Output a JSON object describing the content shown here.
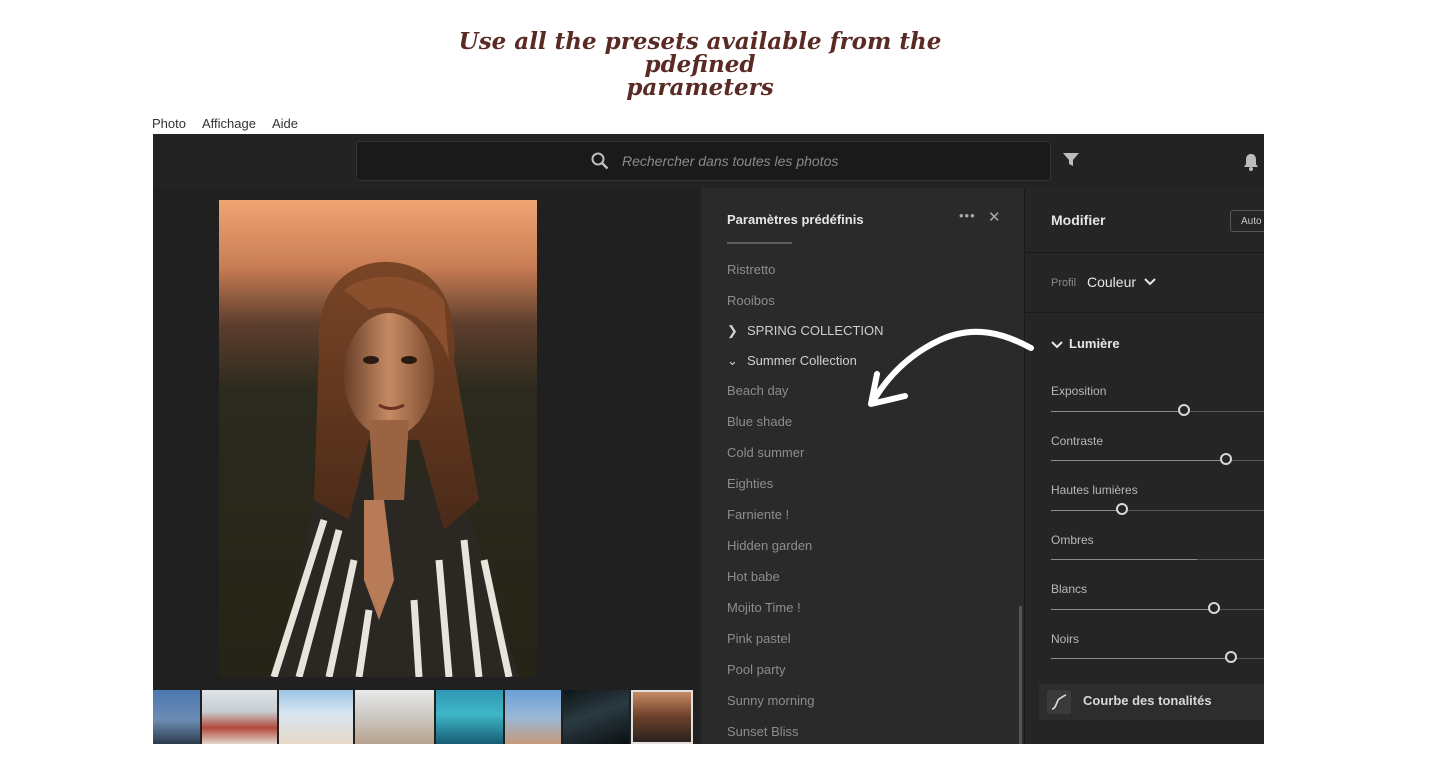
{
  "headline": {
    "line1": "Use all the presets available from the pdefined",
    "line2": "parameters"
  },
  "menubar": [
    "Photo",
    "Affichage",
    "Aide"
  ],
  "search": {
    "placeholder": "Rechercher dans toutes les photos",
    "icon": "search-icon"
  },
  "toolbar_icons": [
    "filter-icon",
    "bell-icon"
  ],
  "presets_panel": {
    "title": "Paramètres prédéfinis",
    "more": "•••",
    "close": "✕",
    "items_before": [
      "Ristretto",
      "Rooibos"
    ],
    "group_collapsed": "SPRING COLLECTION",
    "group_expanded": "Summer Collection",
    "summer_items": [
      "Beach day",
      "Blue shade",
      "Cold summer",
      "Eighties",
      "Farniente !",
      "Hidden garden",
      "Hot babe",
      "Mojito Time !",
      "Pink pastel",
      "Pool party",
      "Sunny morning",
      "Sunset Bliss"
    ]
  },
  "edit_panel": {
    "title": "Modifier",
    "auto_label": "Auto",
    "profile_label": "Profil",
    "profile_value": "Couleur",
    "section_light": "Lumière",
    "sliders": [
      {
        "name": "exposure",
        "label": "Exposition",
        "level": 0.62
      },
      {
        "name": "contrast",
        "label": "Contraste",
        "level": 0.82
      },
      {
        "name": "highlights",
        "label": "Hautes lumières",
        "level": 0.33
      },
      {
        "name": "shadows",
        "label": "Ombres",
        "level": 0.68
      },
      {
        "name": "whites",
        "label": "Blancs",
        "level": 0.76
      },
      {
        "name": "blacks",
        "label": "Noirs",
        "level": 0.84
      }
    ],
    "tone_curve_label": "Courbe des tonalités"
  },
  "colors": {
    "headline": "#5a2a24",
    "panel": "#2a2a2a",
    "app_bg": "#1c1c1c"
  }
}
